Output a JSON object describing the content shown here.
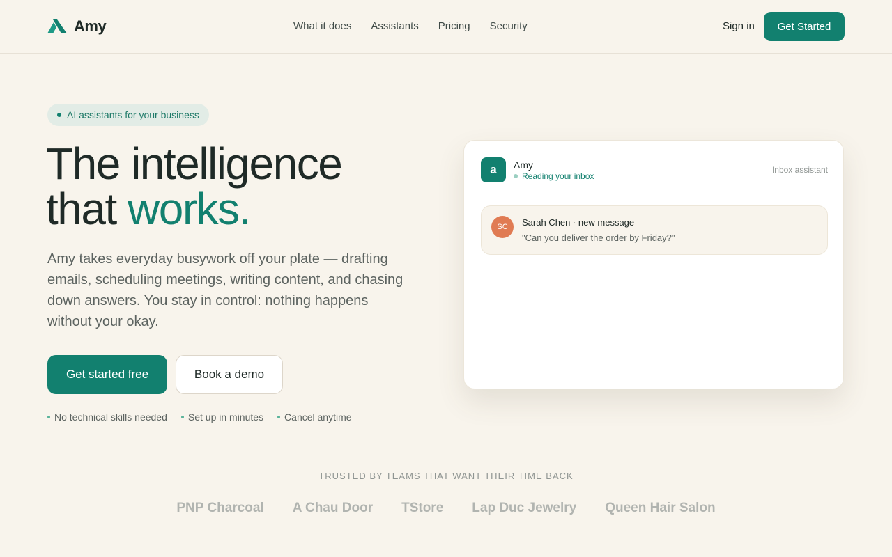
{
  "brand": {
    "name": "Amy",
    "logo_icon": "amy-logo-icon",
    "accent_color": "#12806f"
  },
  "nav": {
    "links": [
      "What it does",
      "Assistants",
      "Pricing",
      "Security"
    ],
    "sign_in": "Sign in",
    "cta": "Get Started"
  },
  "hero": {
    "badge": "AI assistants for your business",
    "headline_line1": "The intelligence",
    "headline_line2_prefix": "that ",
    "headline_accent": "works.",
    "subtext": "Amy takes everyday busywork off your plate — drafting emails, scheduling meetings, writing content, and chasing down answers. You stay in control: nothing happens without your okay.",
    "primary_cta": "Get started free",
    "secondary_cta": "Book a demo",
    "perks": [
      "No technical skills needed",
      "Set up in minutes",
      "Cancel anytime"
    ]
  },
  "card": {
    "avatar_letter": "a",
    "name": "Amy",
    "status": "Reading your inbox",
    "tag": "Inbox assistant",
    "message": {
      "initials": "SC",
      "title": "Sarah Chen · new message",
      "body": "\"Can you deliver the order by Friday?\""
    }
  },
  "trusted": {
    "label": "TRUSTED BY TEAMS THAT WANT THEIR TIME BACK",
    "companies": [
      "PNP Charcoal",
      "A Chau Door",
      "TStore",
      "Lap Duc Jewelry",
      "Queen Hair Salon"
    ]
  }
}
